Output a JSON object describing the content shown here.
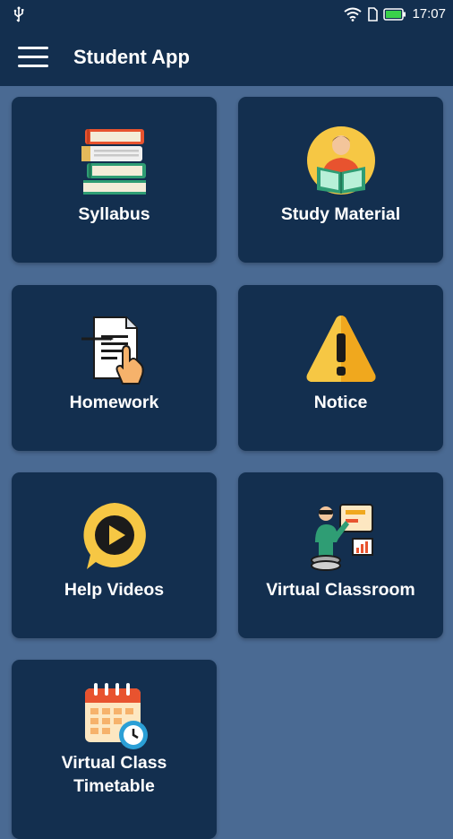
{
  "status_bar": {
    "time": "17:07",
    "icons": [
      "usb-icon",
      "wifi-icon",
      "sim-icon",
      "battery-icon"
    ]
  },
  "app_bar": {
    "title": "Student App",
    "menu_icon": "menu-icon"
  },
  "colors": {
    "background": "#4a6a93",
    "bar": "#132f4f",
    "card": "#132f4f",
    "text": "#ffffff"
  },
  "tiles": [
    {
      "label": "Syllabus",
      "icon": "books-icon"
    },
    {
      "label": "Study Material",
      "icon": "reading-student-icon"
    },
    {
      "label": "Homework",
      "icon": "homework-document-icon"
    },
    {
      "label": "Notice",
      "icon": "warning-icon"
    },
    {
      "label": "Help Videos",
      "icon": "play-video-icon"
    },
    {
      "label": "Virtual Classroom",
      "icon": "virtual-classroom-icon"
    },
    {
      "label": "Virtual Class\nTimetable",
      "icon": "calendar-clock-icon"
    }
  ]
}
